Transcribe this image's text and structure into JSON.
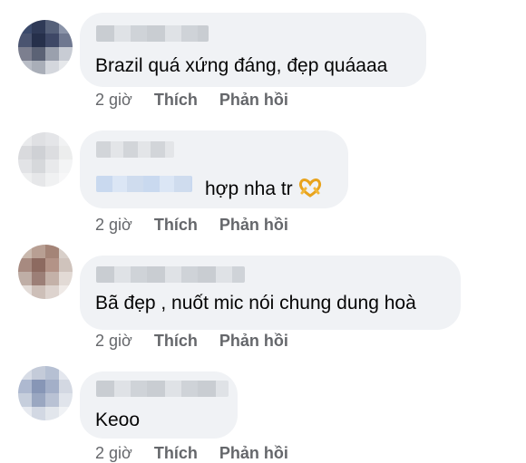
{
  "comments": [
    {
      "text": "Brazil quá xứng đáng, đẹp quáaaa",
      "time": "2 giờ",
      "like_label": "Thích",
      "reply_label": "Phản hồi"
    },
    {
      "text": "hợp nha tr",
      "emoji": "heart-hands-icon",
      "time": "2 giờ",
      "like_label": "Thích",
      "reply_label": "Phản hồi"
    },
    {
      "text": "Bã đẹp , nuốt mic nói chung dung hoà",
      "time": "2 giờ",
      "like_label": "Thích",
      "reply_label": "Phản hồi"
    },
    {
      "text": "Keoo",
      "time": "2 giờ",
      "like_label": "Thích",
      "reply_label": "Phản hồi"
    }
  ],
  "colors": {
    "bubble": "#f0f2f5",
    "meta_text": "#65676b",
    "comment_text": "#050505"
  }
}
